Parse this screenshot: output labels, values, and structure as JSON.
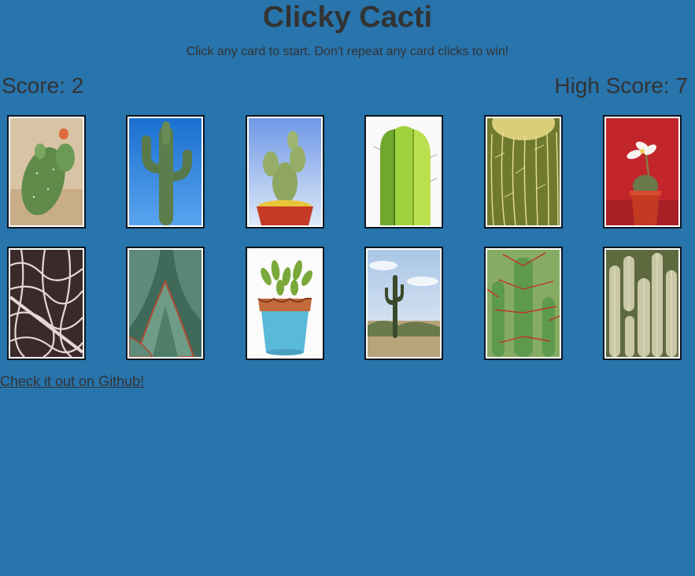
{
  "header": {
    "title": "Clicky Cacti",
    "subtitle": "Click any card to start. Don't repeat any card clicks to win!"
  },
  "scoreboard": {
    "score_text": "Score: 2",
    "high_score_text": "High Score: 7"
  },
  "cards": [
    {
      "icon": "prickly-pear-cactus-icon"
    },
    {
      "icon": "saguaro-sky-cactus-icon"
    },
    {
      "icon": "bunny-ears-potted-cactus-icon"
    },
    {
      "icon": "columnar-cactus-icon"
    },
    {
      "icon": "golden-barrel-cactus-icon"
    },
    {
      "icon": "flowering-potted-cactus-icon"
    },
    {
      "icon": "cactus-skeleton-icon"
    },
    {
      "icon": "agave-leaves-icon"
    },
    {
      "icon": "jade-succulent-pot-icon"
    },
    {
      "icon": "desert-saguaro-icon"
    },
    {
      "icon": "red-spine-cactus-icon"
    },
    {
      "icon": "white-columns-cactus-icon"
    }
  ],
  "footer": {
    "github_link": "Check it out on Github!"
  },
  "colors": {
    "background": "#2874ac",
    "text": "#333333",
    "card_border": "#0b1620"
  }
}
